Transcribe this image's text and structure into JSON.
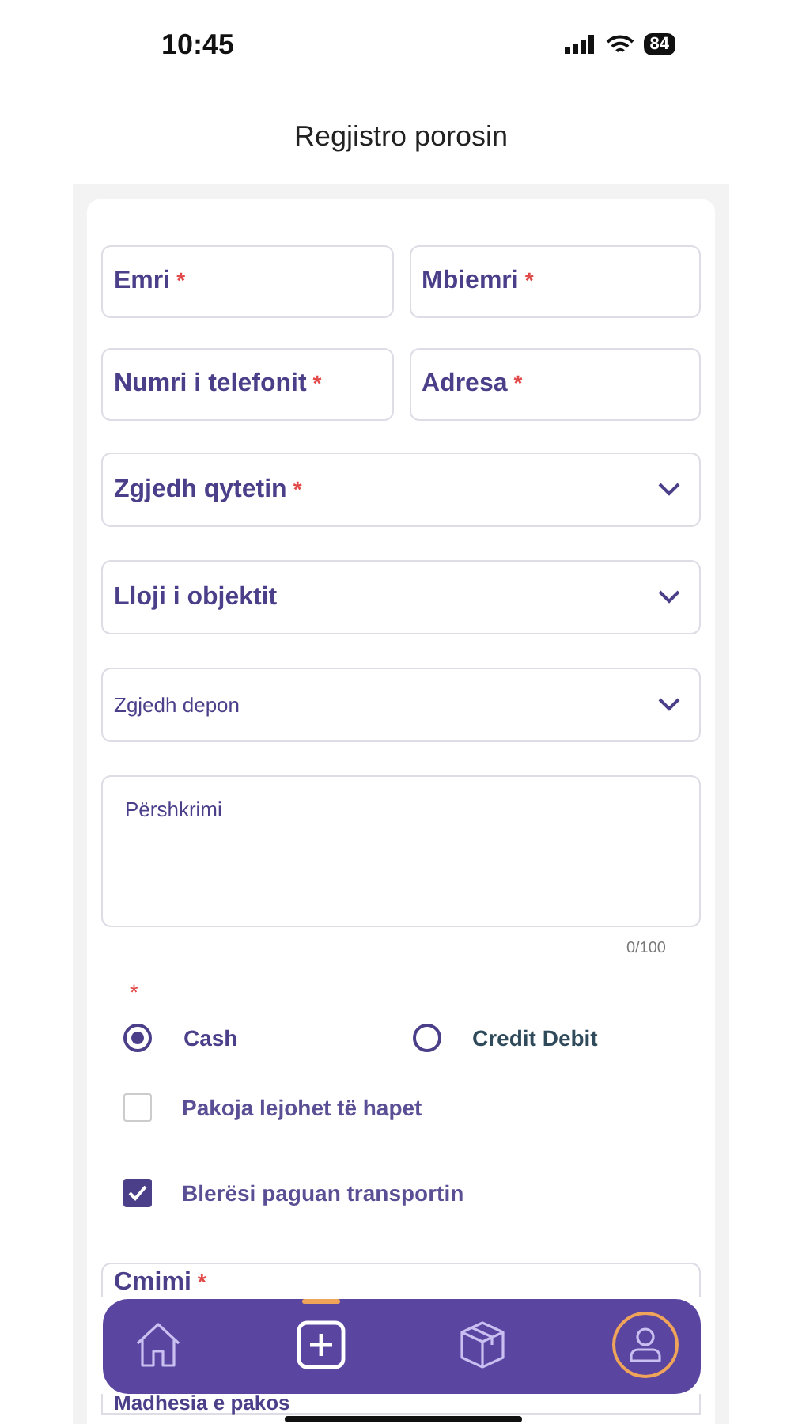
{
  "status_bar": {
    "time": "10:45",
    "battery": "84"
  },
  "title": "Regjistro porosin",
  "name_fields": [
    {
      "label": "Emri",
      "mark": "*"
    },
    {
      "label": "Mbiemri",
      "mark": "*"
    }
  ],
  "contact_fields": [
    {
      "label": "Numri i telefonit",
      "mark": "*"
    },
    {
      "label": "Adresa",
      "mark": "*"
    }
  ],
  "selects": [
    {
      "label": "Zgjedh qytetin",
      "mark": "*",
      "small": false
    },
    {
      "label": "Lloji i objektit",
      "small": false
    },
    {
      "label": "Zgjedh depon",
      "small": true
    }
  ],
  "description": {
    "placeholder": "Përshkrimi",
    "counter": "0/100"
  },
  "payment": {
    "mark": "*",
    "options": [
      {
        "label": "Cash",
        "selected": true
      },
      {
        "label": "Credit Debit",
        "selected": false
      }
    ]
  },
  "checkboxes": [
    {
      "label": "Pakoja lejohet të hapet",
      "checked": false
    },
    {
      "label": "Blerësi paguan transportin",
      "checked": true
    }
  ],
  "price_field": {
    "label": "Cmimi",
    "mark": "*"
  },
  "size_select": {
    "label": "Madhesia e pakos"
  },
  "nav": [
    {
      "kind": "home",
      "selected": false,
      "ringed": false
    },
    {
      "kind": "add",
      "selected": true,
      "ringed": false
    },
    {
      "kind": "box",
      "selected": false,
      "ringed": false
    },
    {
      "kind": "profile",
      "selected": false,
      "ringed": true
    }
  ]
}
